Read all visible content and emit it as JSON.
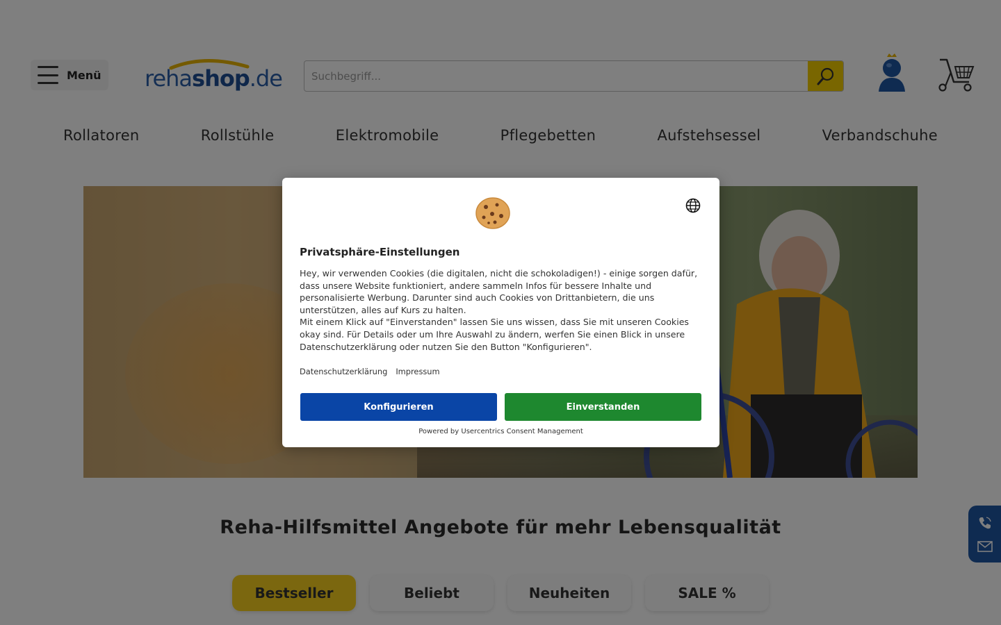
{
  "header": {
    "menu_label": "Menü",
    "logo": {
      "part1": "reha",
      "part2": "shop",
      "part3": ".de"
    },
    "search_placeholder": "Suchbegriff..."
  },
  "categories": [
    "Rollatoren",
    "Rollstühle",
    "Elektromobile",
    "Pflegebetten",
    "Aufstehsessel",
    "Verbandschuhe"
  ],
  "main": {
    "headline": "Reha-Hilfsmittel Angebote für mehr Lebensqualität",
    "tabs": [
      {
        "label": "Bestseller",
        "active": true
      },
      {
        "label": "Beliebt",
        "active": false
      },
      {
        "label": "Neuheiten",
        "active": false
      },
      {
        "label": "SALE %",
        "active": false
      }
    ]
  },
  "consent": {
    "title": "Privatsphäre-Einstellungen",
    "paragraph1": "Hey, wir verwenden Cookies (die digitalen, nicht die schokoladigen!) - einige sorgen dafür, dass unsere Website funktioniert, andere sammeln Infos für bessere Inhalte und personalisierte Werbung. Darunter sind auch Cookies von Drittanbietern, die uns unterstützen, alles auf Kurs zu halten.",
    "paragraph2": "Mit einem Klick auf \"Einverstanden\" lassen Sie uns wissen, dass Sie mit unseren Cookies okay sind. Für Details oder um Ihre Auswahl zu ändern, werfen Sie einen Blick in unsere Datenschutzerklärung oder nutzen Sie den Button \"Konfigurieren\".",
    "links": [
      "Datenschutzerklärung",
      "Impressum"
    ],
    "configure_label": "Konfigurieren",
    "accept_label": "Einverstanden",
    "powered_by": "Powered by Usercentrics Consent Management"
  },
  "colors": {
    "brand_blue": "#1f4f95",
    "accent_yellow": "#f2cc00",
    "configure_button": "#0a45a6",
    "accept_button": "#1e882f",
    "contact_widget": "#1f56a3"
  },
  "icons": [
    "hamburger-icon",
    "search-icon",
    "account-icon",
    "cart-icon",
    "cookie-icon",
    "globe-icon",
    "phone-icon",
    "mail-icon"
  ]
}
